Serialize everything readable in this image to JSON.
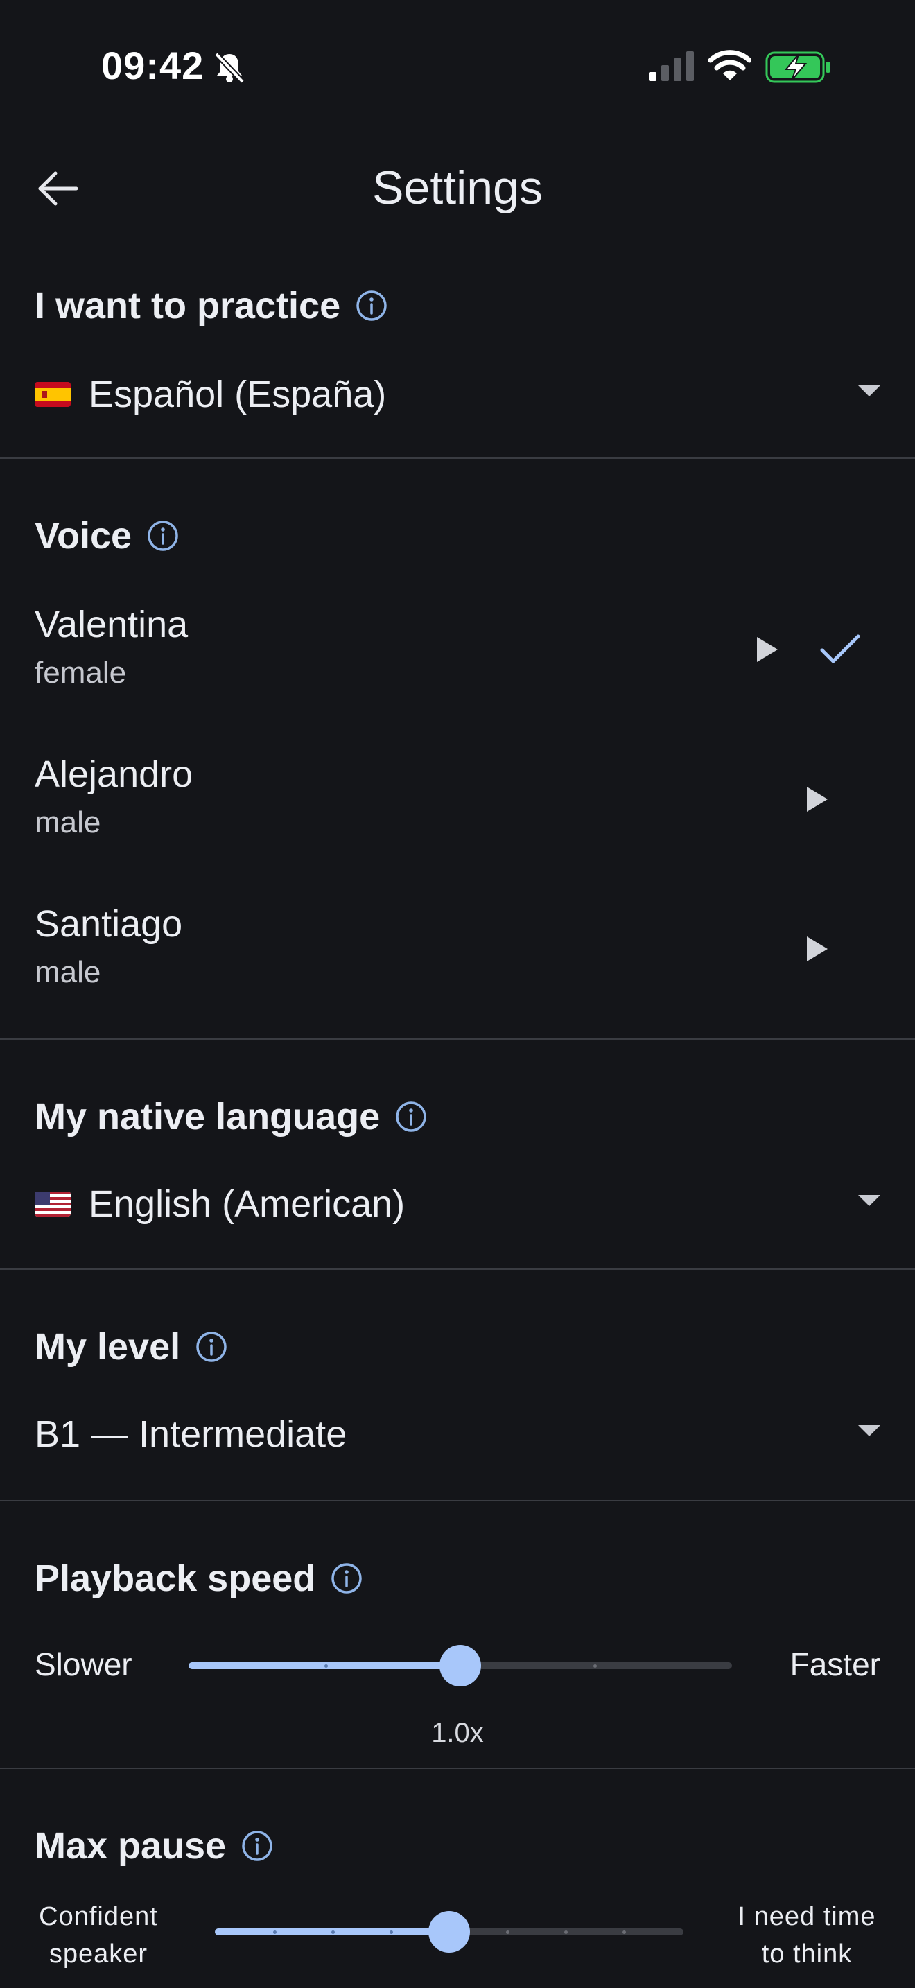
{
  "status_bar": {
    "time": "09:42",
    "icons": [
      "bell-slash-icon",
      "signal-icon",
      "wifi-icon",
      "battery-charging-icon"
    ],
    "battery_color": "#34c759"
  },
  "header": {
    "title": "Settings",
    "back_icon": "arrow-left-icon"
  },
  "practice": {
    "title": "I want to practice",
    "flag": "es-flag",
    "value": "Español (España)"
  },
  "voice": {
    "title": "Voice",
    "items": [
      {
        "name": "Valentina",
        "gender": "female",
        "selected": true
      },
      {
        "name": "Alejandro",
        "gender": "male",
        "selected": false
      },
      {
        "name": "Santiago",
        "gender": "male",
        "selected": false
      }
    ]
  },
  "native": {
    "title": "My native language",
    "flag": "us-flag",
    "value": "English (American)"
  },
  "level": {
    "title": "My level",
    "value": "B1 — Intermediate"
  },
  "playback": {
    "title": "Playback speed",
    "min_label": "Slower",
    "max_label": "Faster",
    "value_label": "1.0x",
    "position_fraction": 0.5
  },
  "max_pause": {
    "title": "Max pause",
    "min_label_1": "Confident",
    "min_label_2": "speaker",
    "max_label_1": "I need time",
    "max_label_2": "to think",
    "position_fraction": 0.5
  },
  "colors": {
    "accent": "#a8c7fa",
    "background": "#141519",
    "divider": "#3a3c42",
    "info_icon": "#8fb4e8"
  }
}
